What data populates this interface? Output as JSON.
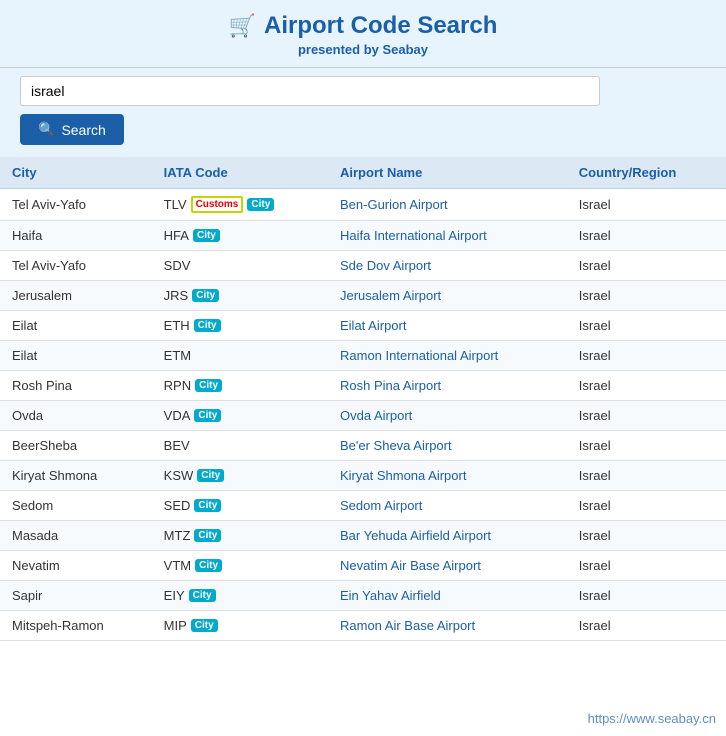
{
  "header": {
    "icon": "🛒",
    "title": "Airport Code Search",
    "subtitle_pre": "presented by ",
    "subtitle_brand": "Seabay"
  },
  "search": {
    "input_value": "israel",
    "input_placeholder": "israel",
    "button_label": "Search"
  },
  "table": {
    "columns": [
      "City",
      "IATA Code",
      "Airport Name",
      "Country/Region"
    ],
    "rows": [
      {
        "city": "Tel Aviv-Yafo",
        "iata": "TLV",
        "badges": [
          "customs",
          "city"
        ],
        "airport": "Ben-Gurion Airport",
        "country": "Israel"
      },
      {
        "city": "Haifa",
        "iata": "HFA",
        "badges": [
          "city"
        ],
        "airport": "Haifa International Airport",
        "country": "Israel"
      },
      {
        "city": "Tel Aviv-Yafo",
        "iata": "SDV",
        "badges": [],
        "airport": "Sde Dov Airport",
        "country": "Israel"
      },
      {
        "city": "Jerusalem",
        "iata": "JRS",
        "badges": [
          "city"
        ],
        "airport": "Jerusalem Airport",
        "country": "Israel"
      },
      {
        "city": "Eilat",
        "iata": "ETH",
        "badges": [
          "city"
        ],
        "airport": "Eilat Airport",
        "country": "Israel"
      },
      {
        "city": "Eilat",
        "iata": "ETM",
        "badges": [],
        "airport": "Ramon International Airport",
        "country": "Israel"
      },
      {
        "city": "Rosh Pina",
        "iata": "RPN",
        "badges": [
          "city"
        ],
        "airport": "Rosh Pina Airport",
        "country": "Israel"
      },
      {
        "city": "Ovda",
        "iata": "VDA",
        "badges": [
          "city"
        ],
        "airport": "Ovda Airport",
        "country": "Israel"
      },
      {
        "city": "BeerSheba",
        "iata": "BEV",
        "badges": [],
        "airport": "Be'er Sheva Airport",
        "country": "Israel"
      },
      {
        "city": "Kiryat Shmona",
        "iata": "KSW",
        "badges": [
          "city"
        ],
        "airport": "Kiryat Shmona Airport",
        "country": "Israel"
      },
      {
        "city": "Sedom",
        "iata": "SED",
        "badges": [
          "city"
        ],
        "airport": "Sedom Airport",
        "country": "Israel"
      },
      {
        "city": "Masada",
        "iata": "MTZ",
        "badges": [
          "city"
        ],
        "airport": "Bar Yehuda Airfield Airport",
        "country": "Israel"
      },
      {
        "city": "Nevatim",
        "iata": "VTM",
        "badges": [
          "city"
        ],
        "airport": "Nevatim Air Base Airport",
        "country": "Israel"
      },
      {
        "city": "Sapir",
        "iata": "EIY",
        "badges": [
          "city"
        ],
        "airport": "Ein Yahav Airfield",
        "country": "Israel"
      },
      {
        "city": "Mitspeh-Ramon",
        "iata": "MIP",
        "badges": [
          "city"
        ],
        "airport": "Ramon Air Base Airport",
        "country": "Israel"
      }
    ]
  },
  "watermark": "https://www.seabay.cn",
  "badge_labels": {
    "customs": "Customs",
    "city": "City"
  }
}
